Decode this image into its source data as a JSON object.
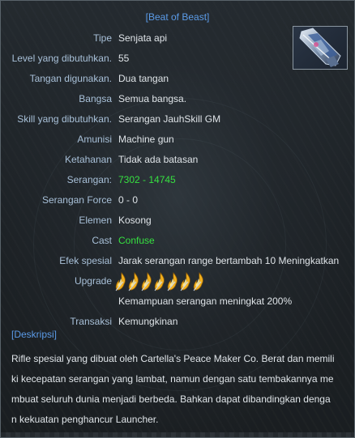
{
  "item": {
    "title": "[Beat of Beast]"
  },
  "rows": {
    "tipe": {
      "label": "Tipe",
      "value": "Senjata api"
    },
    "level": {
      "label": "Level yang dibutuhkan.",
      "value": "55"
    },
    "tangan": {
      "label": "Tangan digunakan.",
      "value": "Dua tangan"
    },
    "bangsa": {
      "label": "Bangsa",
      "value": "Semua bangsa."
    },
    "skill": {
      "label": "Skill yang dibutuhkan.",
      "value": "Serangan JauhSkill GM"
    },
    "amunisi": {
      "label": "Amunisi",
      "value": "Machine gun"
    },
    "ketahanan": {
      "label": "Ketahanan",
      "value": "Tidak ada batasan"
    },
    "serangan": {
      "label": "Serangan:",
      "value": "7302 - 14745"
    },
    "serangan_force": {
      "label": "Serangan Force",
      "value": "0 - 0"
    },
    "elemen": {
      "label": "Elemen",
      "value": "Kosong"
    },
    "cast": {
      "label": "Cast",
      "value": "Confuse"
    },
    "efek": {
      "label": "Efek spesial",
      "value": "Jarak serangan range bertambah 10 Meningkatkan"
    },
    "upgrade": {
      "label": "Upgrade",
      "icon_count": 7,
      "icon": "flame-upgrade-icon"
    },
    "kemampuan": {
      "value": "Kemampuan serangan meningkat 200%"
    },
    "transaksi": {
      "label": "Transaksi",
      "value": "Kemungkinan"
    }
  },
  "description": {
    "heading": "[Deskripsi]",
    "lines": [
      "Rifle spesial yang dibuat oleh Cartella's Peace Maker Co. Berat dan memili",
      "ki kecepatan serangan yang lambat, namun dengan satu tembakannya me",
      "mbuat seluruh dunia menjadi berbeda. Bahkan dapat dibandingkan denga",
      "n kekuatan penghancur Launcher."
    ]
  },
  "colors": {
    "title": "#5b9be8",
    "label": "#a8c0d8",
    "value": "#dfe4e8",
    "highlight": "#36e040"
  }
}
